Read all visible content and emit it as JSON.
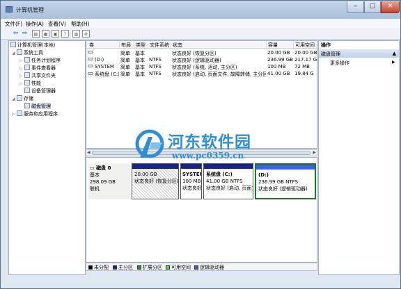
{
  "window": {
    "title": "计算机管理"
  },
  "menu": [
    "文件(F)",
    "操作(A)",
    "查看(V)",
    "帮助(H)"
  ],
  "tree": {
    "root": "计算机管理(本地)",
    "items": [
      "系统工具",
      "任务计划程序",
      "事件查看器",
      "共享文件夹",
      "性能",
      "设备管理器",
      "存储",
      "磁盘管理",
      "服务和应用程序"
    ]
  },
  "volumes": {
    "headers": [
      "卷",
      "布局",
      "类型",
      "文件系统",
      "状态",
      "容量",
      "可用空间"
    ],
    "rows": [
      [
        "",
        "简单",
        "基本",
        "",
        "状态良好 (恢复分区)",
        "20.00 GB",
        "20.00 GB"
      ],
      [
        "(D:)",
        "简单",
        "基本",
        "NTFS",
        "状态良好 (逻辑驱动器)",
        "236.99 GB",
        "217.17 G"
      ],
      [
        "SYSTEM",
        "简单",
        "基本",
        "NTFS",
        "状态良好 (系统, 活动, 主分区)",
        "100 MB",
        "72 MB"
      ],
      [
        "系统盘 (C:)",
        "简单",
        "基本",
        "NTFS",
        "状态良好 (启动, 页面文件, 故障转储, 主分区)",
        "41.00 GB",
        "19.84 G"
      ]
    ]
  },
  "disk": {
    "name": "磁盘 0",
    "type": "基本",
    "size": "298.09 GB",
    "state": "联机",
    "partitions": [
      {
        "label": "",
        "size": "20.00 GB",
        "status": "状态良好 (恢复分区)"
      },
      {
        "label": "SYSTEM",
        "size": "100 MB",
        "status": "状态良好"
      },
      {
        "label": "系统盘 (C:)",
        "size": "41.00 GB NTFS",
        "status": "状态良好 (启动, 页面文"
      },
      {
        "label": "(D:)",
        "size": "236.99 GB NTFS",
        "status": "状态良好 (逻辑驱动器)"
      }
    ]
  },
  "legend": [
    {
      "label": "未分配",
      "color": "#000000"
    },
    {
      "label": "主分区",
      "color": "#16238c"
    },
    {
      "label": "扩展分区",
      "color": "#2f8a2f"
    },
    {
      "label": "可用空间",
      "color": "#4fdc4f"
    },
    {
      "label": "逻辑驱动器",
      "color": "#3a62d8"
    }
  ],
  "actions": {
    "header": "操作",
    "section": "磁盘管理",
    "more": "更多操作"
  },
  "watermark": {
    "name": "河东软件园",
    "url": "www.pc0359.cn"
  }
}
